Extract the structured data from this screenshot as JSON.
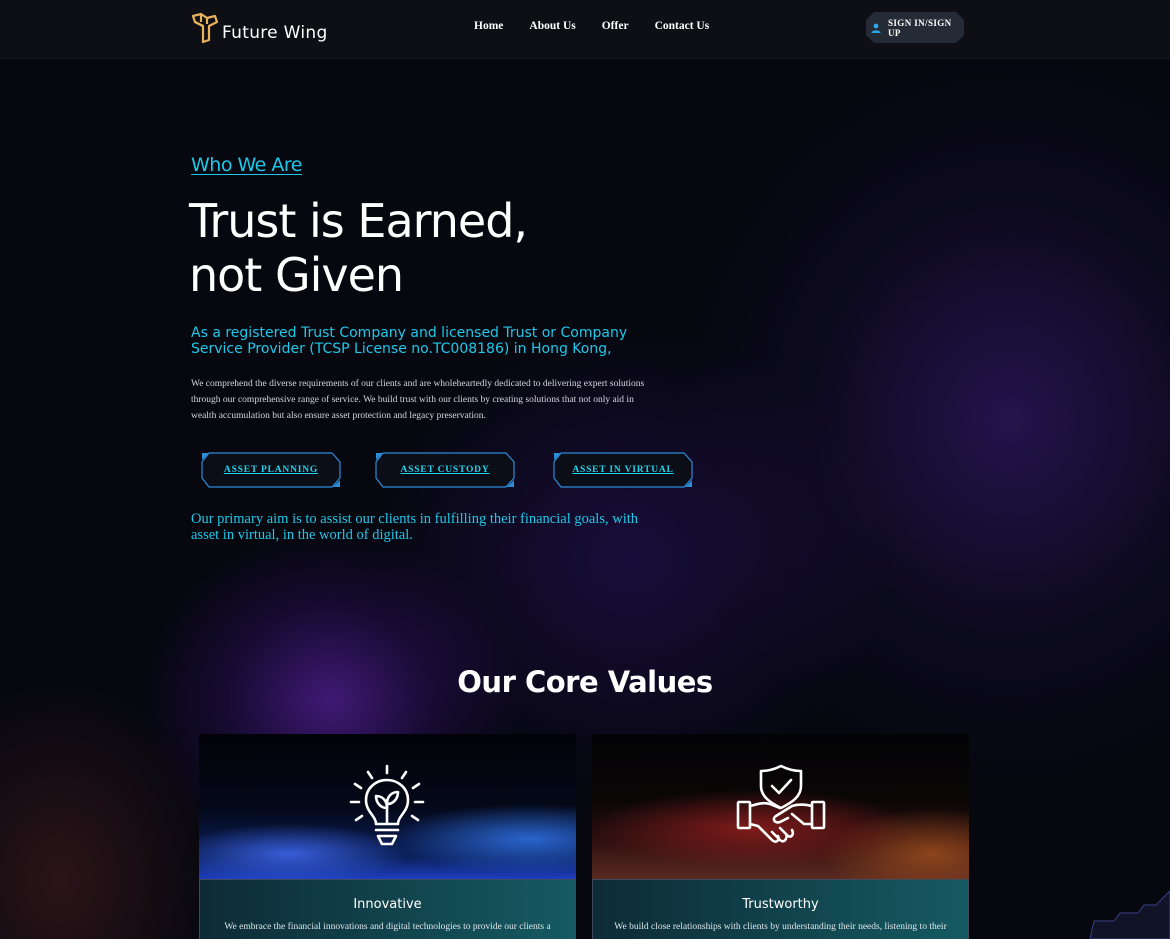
{
  "brand": {
    "name": "Future Wing"
  },
  "nav": {
    "items": [
      "Home",
      "About Us",
      "Offer",
      "Contact Us"
    ]
  },
  "auth": {
    "signin_label": "SIGN IN/SIGN UP"
  },
  "hero": {
    "eyebrow": "Who We Are",
    "headline_line1": "Trust is Earned,",
    "headline_line2": "not Given",
    "subhead": "As a registered Trust Company and licensed Trust or Company Service Provider (TCSP License no.TC008186) in Hong Kong,",
    "description": "We comprehend the diverse requirements of our clients and are wholeheartedly dedicated to delivering expert solutions through our comprehensive range of service. We build trust with our clients by creating solutions that not only aid in wealth accumulation but also ensure asset protection and legacy preservation.",
    "buttons": [
      "ASSET PLANNING",
      "ASSET CUSTODY",
      "ASSET IN VIRTUAL"
    ],
    "aim": "Our primary aim is to assist our clients in fulfilling their financial goals, with asset in virtual, in the world of digital."
  },
  "core_values": {
    "title": "Our Core Values",
    "cards": [
      {
        "icon": "lightbulb-icon",
        "title": "Innovative",
        "text": "We embrace the financial innovations and digital technologies to provide our clients a"
      },
      {
        "icon": "handshake-shield-icon",
        "title": "Trustworthy",
        "text": "We build close relationships with clients by understanding their needs, listening to their"
      }
    ]
  },
  "colors": {
    "accent": "#1ec8e8",
    "header_bg": "#0d0f14",
    "page_bg": "#06070f",
    "button_border": "#2d8bd8"
  }
}
